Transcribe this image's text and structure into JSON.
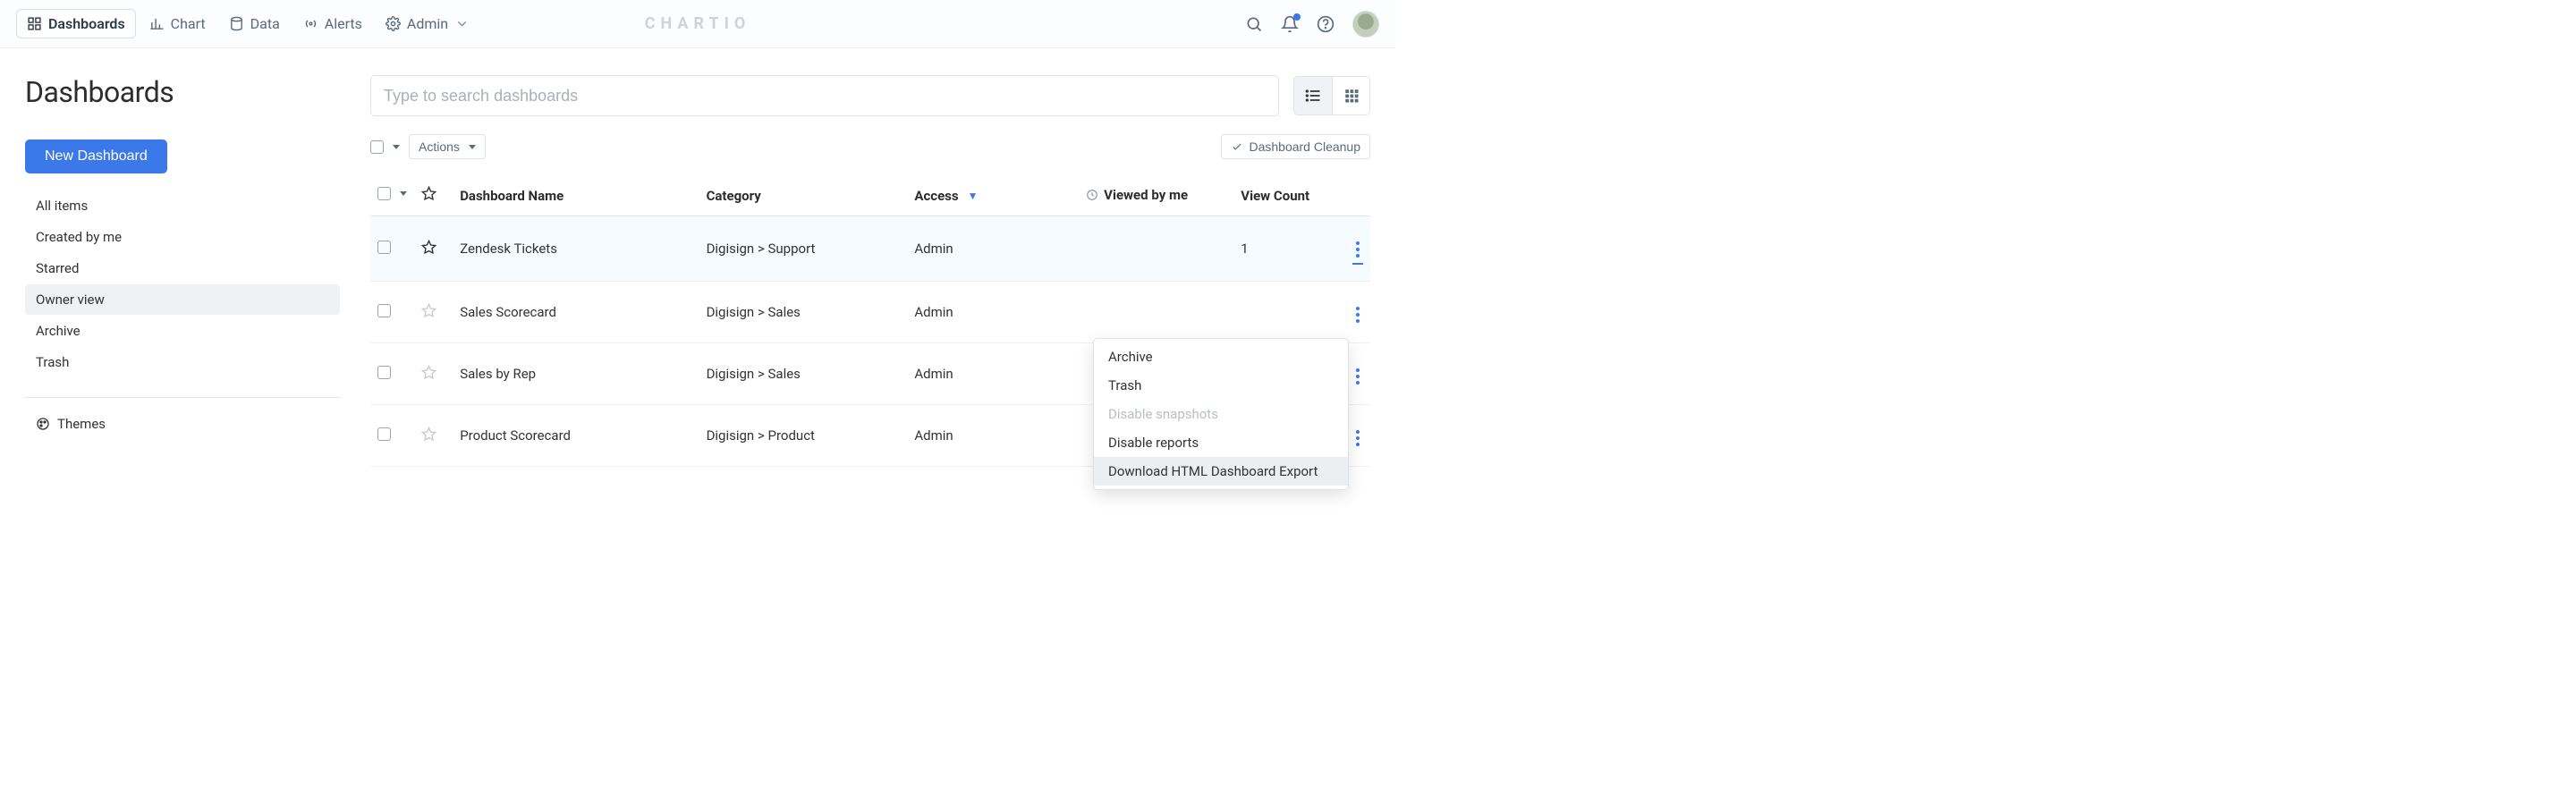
{
  "brand": "CHARTIO",
  "nav": {
    "items": [
      {
        "label": "Dashboards",
        "active": true
      },
      {
        "label": "Chart",
        "active": false
      },
      {
        "label": "Data",
        "active": false
      },
      {
        "label": "Alerts",
        "active": false
      },
      {
        "label": "Admin",
        "active": false,
        "caret": true
      }
    ]
  },
  "page": {
    "title": "Dashboards",
    "new_button": "New Dashboard",
    "search_placeholder": "Type to search dashboards",
    "actions_label": "Actions",
    "cleanup_label": "Dashboard Cleanup",
    "themes_label": "Themes"
  },
  "sidebar": {
    "items": [
      {
        "label": "All items",
        "selected": false
      },
      {
        "label": "Created by me",
        "selected": false
      },
      {
        "label": "Starred",
        "selected": false
      },
      {
        "label": "Owner view",
        "selected": true
      },
      {
        "label": "Archive",
        "selected": false
      },
      {
        "label": "Trash",
        "selected": false
      }
    ]
  },
  "table": {
    "headers": {
      "name": "Dashboard Name",
      "category": "Category",
      "access": "Access",
      "viewed": "Viewed by me",
      "count": "View Count"
    },
    "rows": [
      {
        "name": "Zendesk Tickets",
        "category": "Digisign > Support",
        "access": "Admin",
        "viewed": "",
        "count": "1",
        "starred": true,
        "highlight": true,
        "menu_open": true
      },
      {
        "name": "Sales Scorecard",
        "category": "Digisign > Sales",
        "access": "Admin",
        "viewed": "",
        "count": "",
        "starred": false,
        "highlight": false,
        "menu_open": false
      },
      {
        "name": "Sales by Rep",
        "category": "Digisign > Sales",
        "access": "Admin",
        "viewed": "",
        "count": "",
        "starred": false,
        "highlight": false,
        "menu_open": false
      },
      {
        "name": "Product Scorecard",
        "category": "Digisign > Product",
        "access": "Admin",
        "viewed": "",
        "count": "",
        "starred": false,
        "highlight": false,
        "menu_open": false
      }
    ]
  },
  "dropdown": {
    "items": [
      {
        "label": "Archive",
        "disabled": false,
        "highlight": false
      },
      {
        "label": "Trash",
        "disabled": false,
        "highlight": false
      },
      {
        "label": "Disable snapshots",
        "disabled": true,
        "highlight": false
      },
      {
        "label": "Disable reports",
        "disabled": false,
        "highlight": false
      },
      {
        "label": "Download HTML Dashboard Export",
        "disabled": false,
        "highlight": true
      }
    ]
  }
}
